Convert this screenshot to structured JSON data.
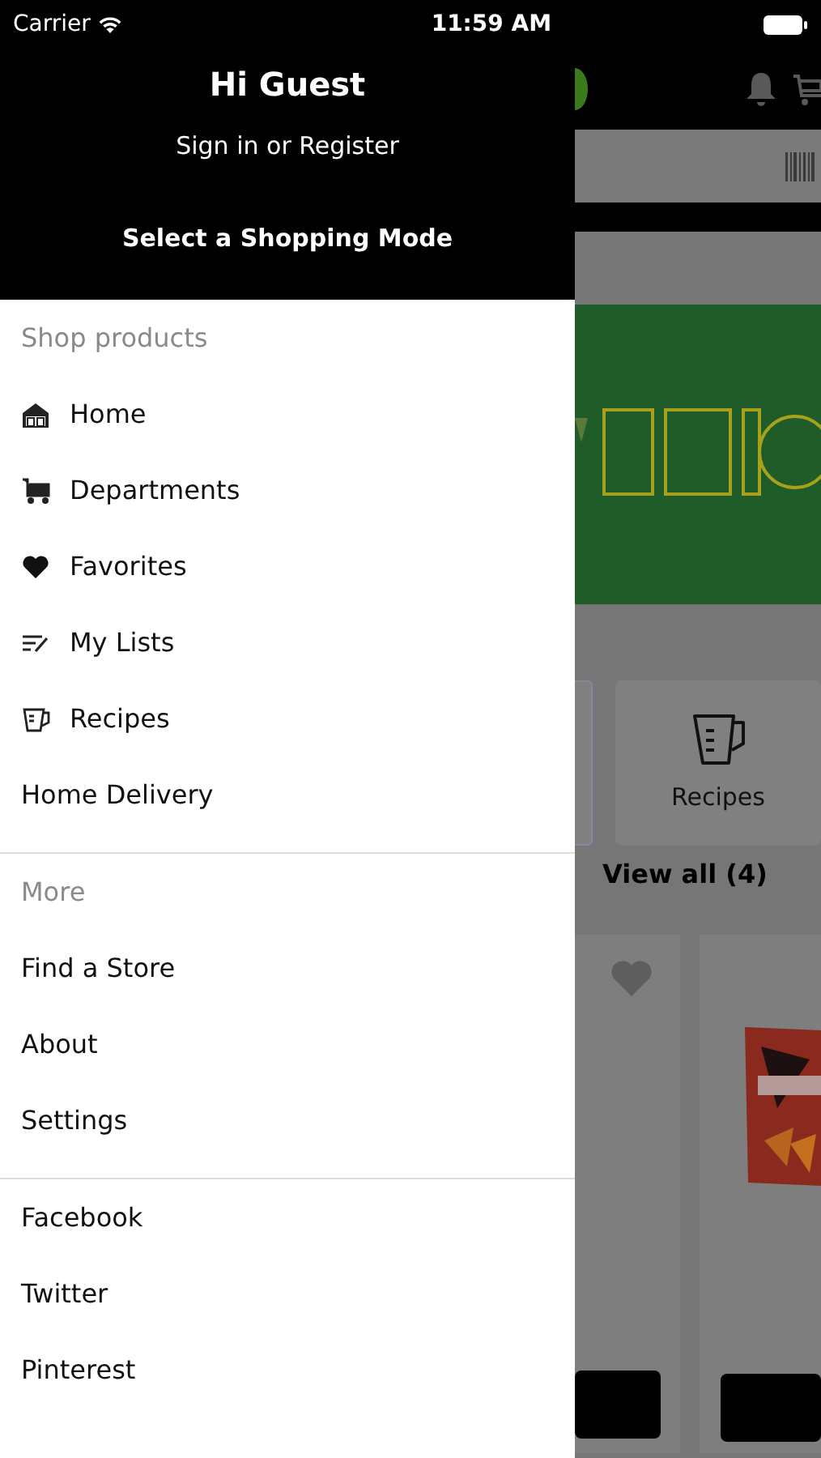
{
  "status_bar": {
    "carrier": "Carrier",
    "time": "11:59 AM"
  },
  "drawer": {
    "greeting": "Hi Guest",
    "sign_in": "Sign in or Register",
    "shopping_mode": "Select a Shopping Mode",
    "sections": [
      {
        "title": "Shop products",
        "items": [
          {
            "label": "Home",
            "kind": "icon"
          },
          {
            "label": "Departments",
            "kind": "icon"
          },
          {
            "label": "Favorites",
            "kind": "icon"
          },
          {
            "label": "My Lists",
            "kind": "icon"
          },
          {
            "label": "Recipes",
            "kind": "icon"
          },
          {
            "label": "Home Delivery",
            "kind": "plain"
          }
        ]
      },
      {
        "title": "More",
        "items": [
          {
            "label": "Find a Store",
            "kind": "plain"
          },
          {
            "label": "About",
            "kind": "plain"
          },
          {
            "label": "Settings",
            "kind": "plain"
          }
        ]
      },
      {
        "items": [
          {
            "label": "Facebook",
            "kind": "plain"
          },
          {
            "label": "Twitter",
            "kind": "plain"
          },
          {
            "label": "Pinterest",
            "kind": "plain"
          }
        ]
      }
    ]
  },
  "background": {
    "tile": {
      "label": "Recipes"
    },
    "view_all": "View all (4)"
  }
}
